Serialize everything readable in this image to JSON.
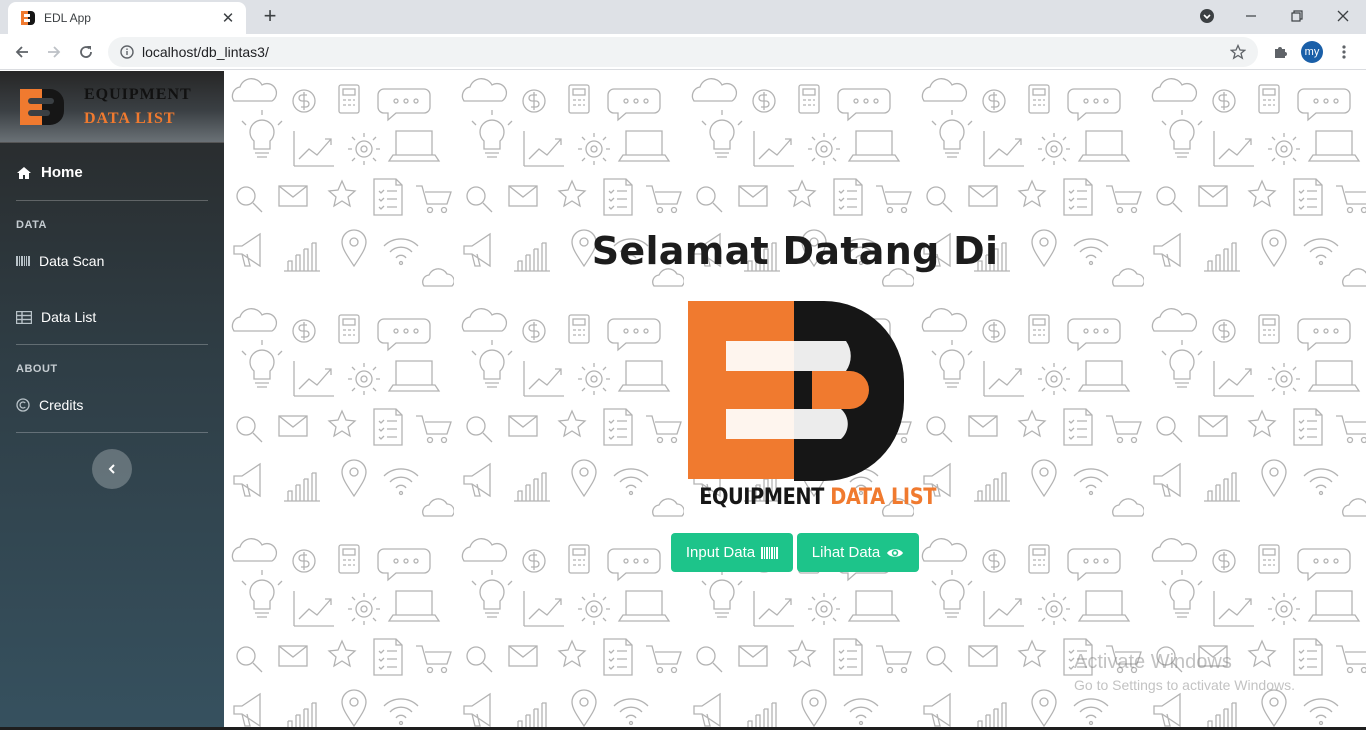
{
  "browser": {
    "tab_title": "EDL App",
    "new_tab": "+",
    "url": "localhost/db_lintas3/",
    "profile_initials": "my"
  },
  "sidebar": {
    "brand_line1": "EQUIPMENT",
    "brand_line2": "DATA LIST",
    "home_label": "Home",
    "section_data": "DATA",
    "data_scan_label": "Data Scan",
    "data_list_label": "Data List",
    "section_about": "ABOUT",
    "credits_label": "Credits"
  },
  "main": {
    "welcome": "Selamat Datang Di",
    "logo_caption_part1": "EQUIPMENT",
    "logo_caption_part2": "DATA LIST",
    "input_button": "Input Data",
    "view_button": "Lihat Data"
  },
  "watermark": {
    "line1": "Activate Windows",
    "line2": "Go to Settings to activate Windows."
  },
  "colors": {
    "brand_orange": "#f07a2f",
    "button_green": "#1dc48a",
    "sidebar_dark": "#2f3e46"
  }
}
